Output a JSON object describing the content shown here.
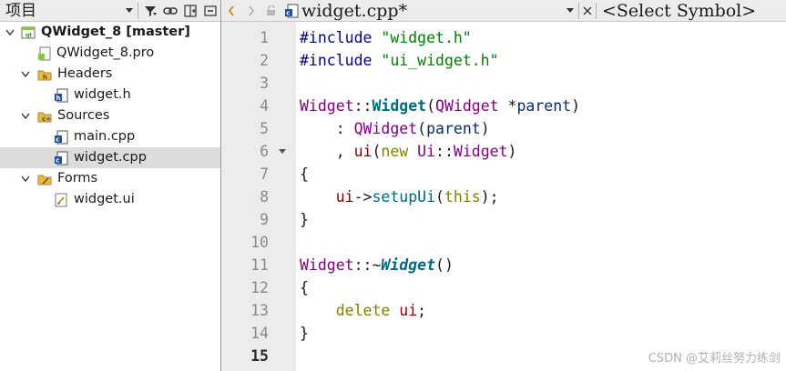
{
  "project_panel": {
    "title": "项目",
    "toolbar_icons": [
      "dropdown-icon",
      "filter-icon",
      "link-icon",
      "split-icon",
      "collapse-icon"
    ]
  },
  "editor_toolbar": {
    "document_name": "widget.cpp*",
    "symbol_selector": "<Select Symbol>",
    "icons": [
      "back-arrow-icon",
      "forward-arrow-icon",
      "lock-icon",
      "cpp-file-icon",
      "dropdown-icon",
      "close-icon"
    ]
  },
  "tree": {
    "project": {
      "label": "QWidget_8 [master]",
      "icon": "qt-project-icon"
    },
    "items": [
      {
        "label": "QWidget_8.pro",
        "icon": "pro-file-icon"
      },
      {
        "label": "Headers",
        "icon": "headers-folder-icon"
      },
      {
        "label": "widget.h",
        "icon": "header-file-icon"
      },
      {
        "label": "Sources",
        "icon": "sources-folder-icon"
      },
      {
        "label": "main.cpp",
        "icon": "cpp-file-icon"
      },
      {
        "label": "widget.cpp",
        "icon": "cpp-file-icon",
        "selected": true
      },
      {
        "label": "Forms",
        "icon": "forms-folder-icon"
      },
      {
        "label": "widget.ui",
        "icon": "ui-file-icon"
      }
    ]
  },
  "code": {
    "current_line": 15,
    "line_numbers": [
      "1",
      "2",
      "3",
      "4",
      "5",
      "6",
      "7",
      "8",
      "9",
      "10",
      "11",
      "12",
      "13",
      "14",
      "15"
    ],
    "lines": [
      [
        {
          "t": "#include ",
          "c": "pre"
        },
        {
          "t": "\"widget.h\"",
          "c": "str"
        }
      ],
      [
        {
          "t": "#include ",
          "c": "pre"
        },
        {
          "t": "\"ui_widget.h\"",
          "c": "str"
        }
      ],
      [],
      [
        {
          "t": "Widget",
          "c": "type"
        },
        {
          "t": "::",
          "c": "op"
        },
        {
          "t": "Widget",
          "c": "fn"
        },
        {
          "t": "(",
          "c": "op"
        },
        {
          "t": "QWidget",
          "c": "type"
        },
        {
          "t": " *",
          "c": "op"
        },
        {
          "t": "parent",
          "c": "param"
        },
        {
          "t": ")",
          "c": "op"
        }
      ],
      [
        {
          "t": "    : ",
          "c": "op"
        },
        {
          "t": "QWidget",
          "c": "type"
        },
        {
          "t": "(",
          "c": "op"
        },
        {
          "t": "parent",
          "c": "param"
        },
        {
          "t": ")",
          "c": "op"
        }
      ],
      [
        {
          "t": "    , ",
          "c": "op"
        },
        {
          "t": "ui",
          "c": "member"
        },
        {
          "t": "(",
          "c": "op"
        },
        {
          "t": "new",
          "c": "kw"
        },
        {
          "t": " ",
          "c": "op"
        },
        {
          "t": "Ui",
          "c": "type"
        },
        {
          "t": "::",
          "c": "op"
        },
        {
          "t": "Widget",
          "c": "type"
        },
        {
          "t": ")",
          "c": "op"
        }
      ],
      [
        {
          "t": "{",
          "c": "op"
        }
      ],
      [
        {
          "t": "    ",
          "c": "op"
        },
        {
          "t": "ui",
          "c": "member"
        },
        {
          "t": "->",
          "c": "op"
        },
        {
          "t": "setupUi",
          "c": "call"
        },
        {
          "t": "(",
          "c": "op"
        },
        {
          "t": "this",
          "c": "kw"
        },
        {
          "t": ");",
          "c": "op"
        }
      ],
      [
        {
          "t": "}",
          "c": "op"
        }
      ],
      [],
      [
        {
          "t": "Widget",
          "c": "type"
        },
        {
          "t": "::~",
          "c": "op"
        },
        {
          "t": "Widget",
          "c": "fni"
        },
        {
          "t": "()",
          "c": "op"
        }
      ],
      [
        {
          "t": "{",
          "c": "op"
        }
      ],
      [
        {
          "t": "    ",
          "c": "op"
        },
        {
          "t": "delete",
          "c": "kw"
        },
        {
          "t": " ",
          "c": "op"
        },
        {
          "t": "ui",
          "c": "member"
        },
        {
          "t": ";",
          "c": "op"
        }
      ],
      [
        {
          "t": "}",
          "c": "op"
        }
      ],
      []
    ]
  },
  "watermark": "CSDN @艾莉丝努力练剑",
  "colors": {
    "preprocessor": "#000080",
    "string": "#008000",
    "type": "#800080",
    "function": "#00677c",
    "keyword": "#808000",
    "member": "#800000",
    "selection": "#dcdcdc",
    "gutter": "#ececec"
  }
}
